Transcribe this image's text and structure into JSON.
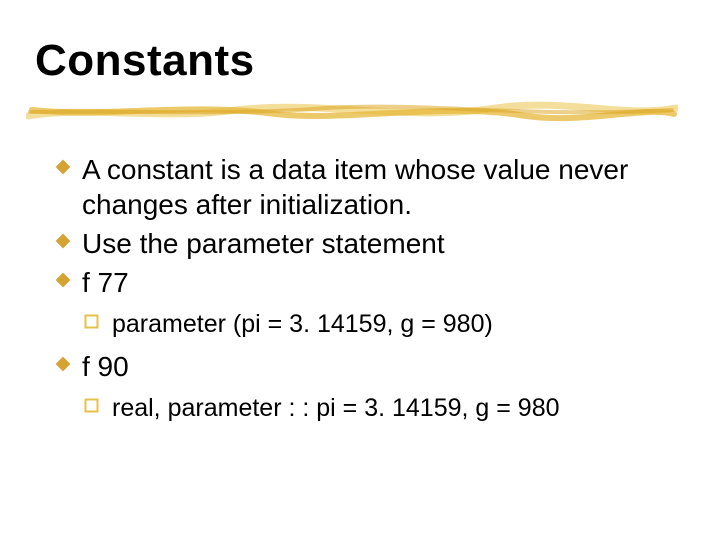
{
  "title": "Constants",
  "bullets": {
    "b1": "A constant is a data item whose value never changes after initialization.",
    "b2": "Use the parameter statement",
    "b3": "f 77",
    "b3a": "parameter (pi = 3. 14159, g = 980)",
    "b4": "f 90",
    "b4a": "real, parameter : : pi = 3. 14159, g = 980"
  },
  "colors": {
    "lvl1": "#d4a332",
    "lvl2": "#e4c14a",
    "stroke": "#e8be3e"
  }
}
